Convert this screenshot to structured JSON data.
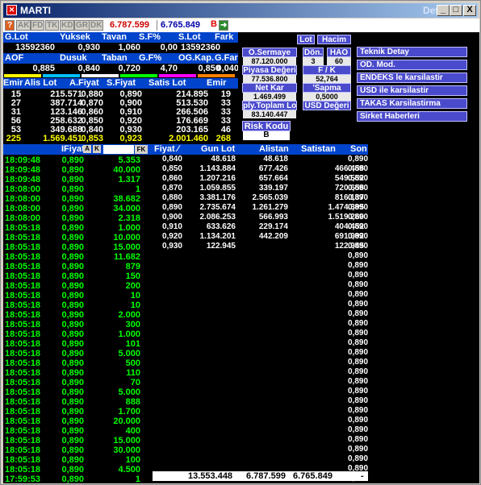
{
  "window": {
    "title": "MARTI",
    "subtitle": "Detay",
    "min_label": "_",
    "max_label": "□",
    "close_label": "X"
  },
  "toolbar": {
    "tabs": [
      "AK",
      "FD",
      "TK",
      "KD",
      "GR",
      "DK"
    ],
    "price1": "6.787.599",
    "price2": "6.765.849",
    "b_label": "B"
  },
  "summary": {
    "headers1": [
      "G.Lot",
      "Yuksek",
      "Tavan",
      "S.F%",
      "S.Lot",
      "Fark"
    ],
    "values1": [
      "13592360",
      "0,930",
      "1,060",
      "0,00",
      "13592360",
      ""
    ],
    "headers2": [
      "AOF",
      "Dusuk",
      "Taban",
      "G.F%",
      "OG.Kap.",
      "G.Fark"
    ],
    "values2": [
      "0,885",
      "0,840",
      "0,720",
      "4,70",
      "0,850",
      "0,040"
    ]
  },
  "depth": {
    "headers": [
      "Emir",
      "Alis Lot",
      "A.Fiyat",
      "S.Fiyat",
      "Satis Lot",
      "Emir"
    ],
    "rows": [
      [
        "15",
        "215.571",
        "0,880",
        "0,890",
        "214.895",
        "19"
      ],
      [
        "27",
        "387.714",
        "0,870",
        "0,900",
        "513.530",
        "33"
      ],
      [
        "31",
        "123.146",
        "0,860",
        "0,910",
        "266.506",
        "33"
      ],
      [
        "56",
        "258.632",
        "0,850",
        "0,920",
        "176.669",
        "33"
      ],
      [
        "53",
        "349.688",
        "0,840",
        "0,930",
        "203.165",
        "46"
      ]
    ],
    "totals": [
      "225",
      "1.569.451",
      "0,853",
      "0,923",
      "2.001.460",
      "268"
    ]
  },
  "info": {
    "lot_btn": "Lot",
    "hacim_btn": "Hacim",
    "sermaye_label": "Ö.Sermaye",
    "sermaye_value": "87.120.000",
    "donem_label": "Dön.",
    "donem_value": "3",
    "hao_label": "HAO",
    "hao_value": "60",
    "piyasa_label": "Piyasa Değeri",
    "piyasa_value": "77.536.800",
    "fk_label": "F / K",
    "fk_value": "52,764",
    "netkar_label": "Net Kar",
    "netkar_value": "1.469.499",
    "sapma_label": "'Sapma",
    "sapma_value": "0,5000",
    "plytoplam_label": "ply.Toplam Lot",
    "plytoplam_value": "83.140.447",
    "usd_label": "USD Değeri",
    "risk_label": "Risk Kodu",
    "risk_value": "B"
  },
  "menu": [
    "Teknik Detay",
    "OD. Mod.",
    "ENDEKS le karsilastir",
    "USD ile karsilastir",
    "TAKAS Karsilastirma",
    "Sirket Haberleri"
  ],
  "trades": {
    "headers": [
      "IFiyat",
      "A",
      "K",
      "",
      "FK"
    ],
    "rows": [
      [
        "18:09:48",
        "0,890",
        "5.353"
      ],
      [
        "18:09:48",
        "0,890",
        "40.000"
      ],
      [
        "18:09:48",
        "0,890",
        "1.317"
      ],
      [
        "18:08:00",
        "0,890",
        "1"
      ],
      [
        "18:08:00",
        "0,890",
        "38.682"
      ],
      [
        "18:08:00",
        "0,890",
        "34.000"
      ],
      [
        "18:08:00",
        "0,890",
        "2.318"
      ],
      [
        "18:05:18",
        "0,890",
        "1.000"
      ],
      [
        "18:05:18",
        "0,890",
        "10.000"
      ],
      [
        "18:05:18",
        "0,890",
        "15.000"
      ],
      [
        "18:05:18",
        "0,890",
        "11.682"
      ],
      [
        "18:05:18",
        "0,890",
        "879"
      ],
      [
        "18:05:18",
        "0,890",
        "150"
      ],
      [
        "18:05:18",
        "0,890",
        "200"
      ],
      [
        "18:05:18",
        "0,890",
        "10"
      ],
      [
        "18:05:18",
        "0,890",
        "10"
      ],
      [
        "18:05:18",
        "0,890",
        "2.000"
      ],
      [
        "18:05:18",
        "0,890",
        "300"
      ],
      [
        "18:05:18",
        "0,890",
        "1.000"
      ],
      [
        "18:05:18",
        "0,890",
        "101"
      ],
      [
        "18:05:18",
        "0,890",
        "5.000"
      ],
      [
        "18:05:18",
        "0,890",
        "500"
      ],
      [
        "18:05:18",
        "0,890",
        "110"
      ],
      [
        "18:05:18",
        "0,890",
        "70"
      ],
      [
        "18:05:18",
        "0,890",
        "5.000"
      ],
      [
        "18:05:18",
        "0,890",
        "888"
      ],
      [
        "18:05:18",
        "0,890",
        "1.700"
      ],
      [
        "18:05:18",
        "0,890",
        "20.000"
      ],
      [
        "18:05:18",
        "0,890",
        "400"
      ],
      [
        "18:05:18",
        "0,890",
        "15.000"
      ],
      [
        "18:05:18",
        "0,890",
        "30.000"
      ],
      [
        "18:05:18",
        "0,890",
        "100"
      ],
      [
        "18:05:18",
        "0,890",
        "4.500"
      ],
      [
        "17:59:53",
        "0,890",
        "1"
      ]
    ]
  },
  "dist": {
    "headers": [
      "Fiyat ∕",
      "Gun Lot",
      "Alistan",
      "Satistan",
      "Son"
    ],
    "rows": [
      [
        "0,840",
        "48.618",
        "48.618",
        "",
        "0,890"
      ],
      [
        "0,850",
        "1.143.884",
        "677.426",
        "466.458",
        "0,890"
      ],
      [
        "0,860",
        "1.207.216",
        "657.664",
        "549.552",
        "0,890"
      ],
      [
        "0,870",
        "1.059.855",
        "339.197",
        "720.658",
        "0,890"
      ],
      [
        "0,880",
        "3.381.176",
        "2.565.039",
        "816.137",
        "0,890"
      ],
      [
        "0,890",
        "2.735.674",
        "1.261.279",
        "1.474.395",
        "0,890"
      ],
      [
        "0,900",
        "2.086.253",
        "566.993",
        "1.519.260",
        "0,890"
      ],
      [
        "0,910",
        "633.626",
        "229.174",
        "404.452",
        "0,890"
      ],
      [
        "0,920",
        "1.134.201",
        "442.209",
        "691.992",
        "0,890"
      ],
      [
        "0,930",
        "122.945",
        "",
        "122.945",
        "0,890"
      ]
    ],
    "son_rest": [
      "0,890",
      "0,890",
      "0,890",
      "0,890",
      "0,890",
      "0,890",
      "0,890",
      "0,890",
      "0,890",
      "0,890",
      "0,890",
      "0,890",
      "0,890",
      "0,890",
      "0,890",
      "0,890",
      "0,890",
      "0,890",
      "0,890",
      "0,890",
      "0,890",
      "0,890",
      "0,890",
      "0,890"
    ],
    "total": [
      "13.553.448",
      "6.787.599",
      "6.765.849",
      "-"
    ]
  }
}
